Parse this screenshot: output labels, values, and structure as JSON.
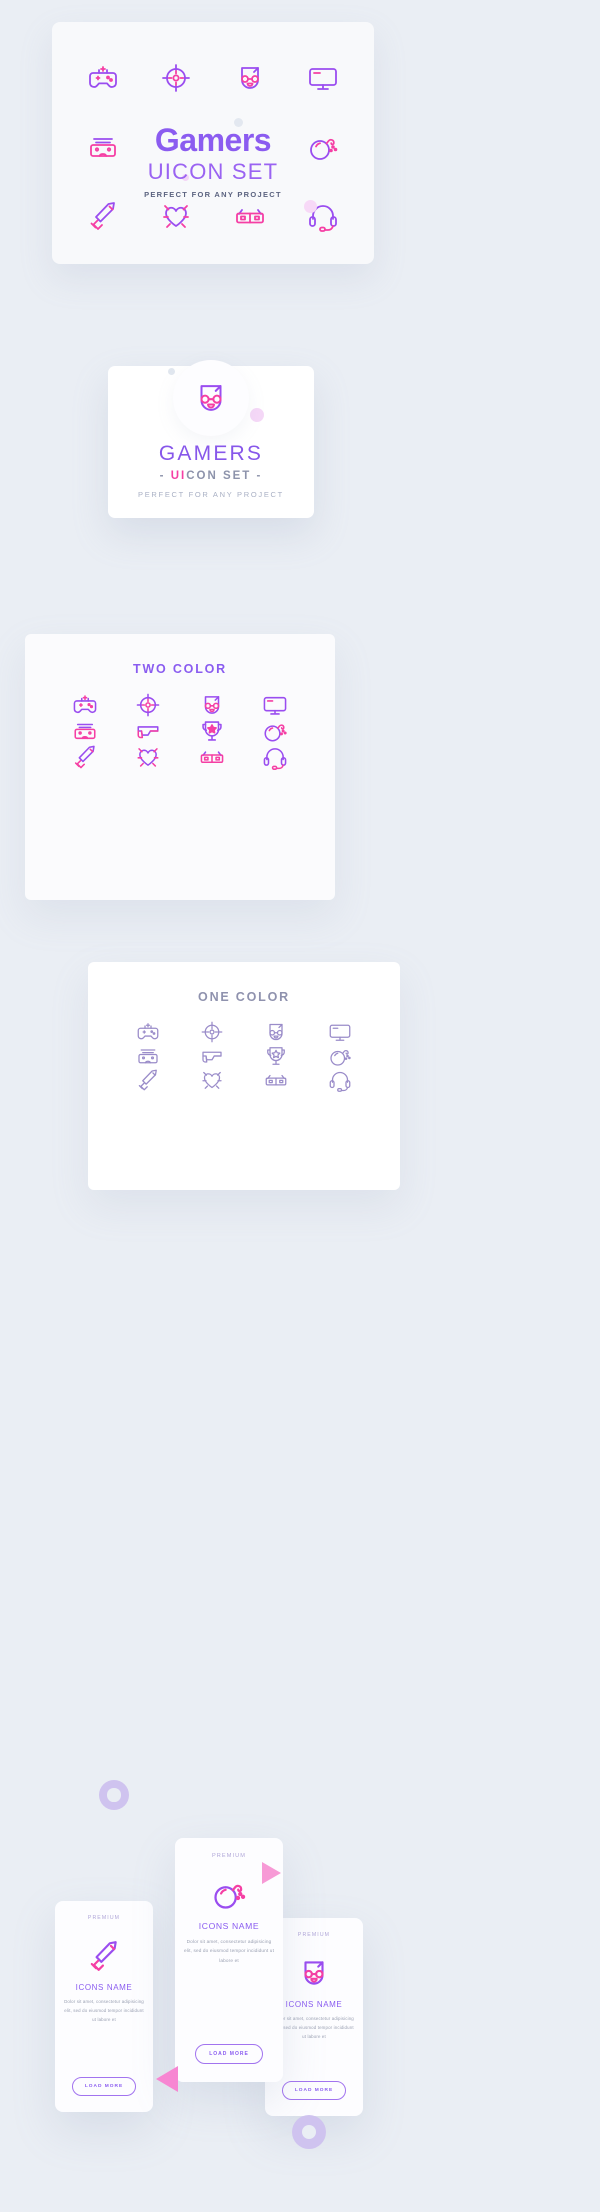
{
  "page": {
    "background_color": "#eaeef4",
    "accent_purple": "#8a5cf0",
    "accent_pink": "#f53fa4"
  },
  "hero": {
    "title": "Gamers",
    "subtitle": "UICON SET",
    "tagline": "PERFECT FOR ANY PROJECT",
    "icons": [
      "gamepad-icon",
      "crosshair-icon",
      "gamer-head-icon",
      "monitor-icon",
      "vr-headset-icon",
      "title-placeholder",
      "title-placeholder",
      "bomb-icon",
      "sword-icon",
      "broken-heart-icon",
      "3d-glasses-icon",
      "headset-icon"
    ]
  },
  "logo_card": {
    "icon": "gamer-head-icon",
    "name": "GAMERS",
    "set_prefix": "- ",
    "set_ui": "UI",
    "set_rest": "CON SET",
    "set_suffix": " -",
    "tagline": "PERFECT FOR ANY PROJECT"
  },
  "sections": [
    {
      "id": "two-color",
      "title": "TWO COLOR",
      "icons": [
        "gamepad-icon",
        "crosshair-icon",
        "gamer-head-icon",
        "monitor-icon",
        "vr-headset-icon",
        "pistol-icon",
        "trophy-icon",
        "bomb-icon",
        "sword-icon",
        "broken-heart-icon",
        "3d-glasses-icon",
        "headset-icon"
      ]
    },
    {
      "id": "one-color",
      "title": "ONE COLOR",
      "icons": [
        "gamepad-icon",
        "crosshair-icon",
        "gamer-head-icon",
        "monitor-icon",
        "vr-headset-icon",
        "pistol-icon",
        "trophy-icon",
        "bomb-icon",
        "sword-icon",
        "broken-heart-icon",
        "3d-glasses-icon",
        "headset-icon"
      ]
    }
  ],
  "premium_cards": [
    {
      "position": "left",
      "badge": "PREMIUM",
      "icon": "sword-icon",
      "title": "ICONS NAME",
      "body": "Dolor sit amet, consectetur adipisicing elit, sed do eiusmod tempor incididunt ut labore et",
      "button": "LOAD MORE"
    },
    {
      "position": "center",
      "badge": "PREMIUM",
      "icon": "bomb-icon",
      "title": "ICONS NAME",
      "body": "Dolor sit amet, consectetur adipisicing elit, sed do eiusmod tempor incididunt ut labore et",
      "button": "LOAD MORE"
    },
    {
      "position": "right",
      "badge": "PREMIUM",
      "icon": "gamer-head-icon",
      "title": "ICONS NAME",
      "body": "Dolor sit amet, consectetur adipisicing elit, sed do eiusmod tempor incididunt ut labore et",
      "button": "LOAD MORE"
    }
  ],
  "decorations": [
    "ring-top",
    "ring-bottom",
    "triangle-right",
    "triangle-left"
  ]
}
